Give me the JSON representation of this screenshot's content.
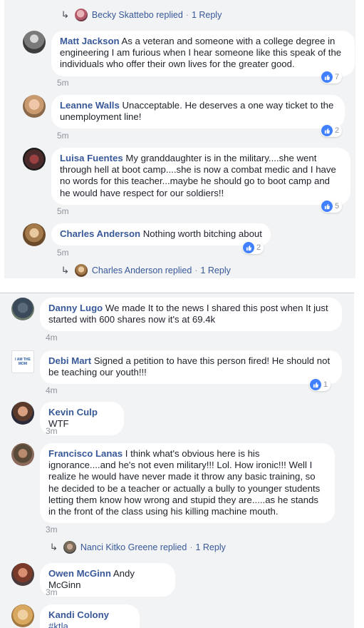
{
  "top_thread": {
    "reply_top": {
      "author": "Becky Skattebo",
      "replied": "replied",
      "count": "1 Reply"
    },
    "comments": [
      {
        "name": "Matt Jackson",
        "text": "As a veteran and someone with a college degree in engineering I am furious when I hear someone like this speak of the individuals who offer their own lives for the greater good.",
        "time": "5m",
        "likes": "7"
      },
      {
        "name": "Leanne Walls",
        "text": "Unacceptable. He deserves a one way ticket to the unemployment line!",
        "time": "5m",
        "likes": "2"
      },
      {
        "name": "Luisa Fuentes",
        "text": "My granddaughter is in the military....she went through hell at boot camp....she is now a combat medic and I have no words for this teacher...maybe he should go to boot camp and he would have respect for our soldiers!!",
        "time": "5m",
        "likes": "5"
      },
      {
        "name": "Charles Anderson",
        "text": "Nothing worth bitching about",
        "time": "5m",
        "likes": "2"
      }
    ],
    "reply_bottom": {
      "author": "Charles Anderson",
      "replied": "replied",
      "count": "1 Reply"
    }
  },
  "bottom_thread": {
    "comments": [
      {
        "name": "Danny Lugo",
        "text": "We made It to the news I shared this post when It just started with 600 shares now it's at 69.4k",
        "time": "4m"
      },
      {
        "name": "Debi Mart",
        "text": "Signed a petition to have this person fired! He should not be teaching our youth!!!",
        "time": "4m",
        "likes": "1"
      },
      {
        "name": "Kevin Culp",
        "text": "WTF",
        "time": "3m"
      },
      {
        "name": "Francisco Lanas",
        "text": "I think what's obvious here is his ignorance....and he's not even military!!! Lol. How ironic!!! Well I realize he would have never made it throw any basic training, so he decided to be a teacher or actually a bully to younger students letting them know how wrong and stupid they are.....as he stands in the front of the class using his killing machine mouth.",
        "time": "3m"
      },
      {
        "name": "Owen McGinn",
        "text": "Andy McGinn",
        "time": "3m"
      },
      {
        "name": "Kandi Colony",
        "text": "#ktla"
      }
    ],
    "reply_francisco": {
      "author": "Nanci Kitko Greene",
      "replied": "replied",
      "count": "1 Reply"
    },
    "logo_text": "I AM THE MOM"
  },
  "icons": {
    "reply": "reply-arrow-icon",
    "like": "like-thumb-icon"
  },
  "colors": {
    "name_link": "#385898",
    "like_blue": "#4080ff",
    "panel_bg": "#f2f3f5",
    "time_gray": "#90949c"
  }
}
